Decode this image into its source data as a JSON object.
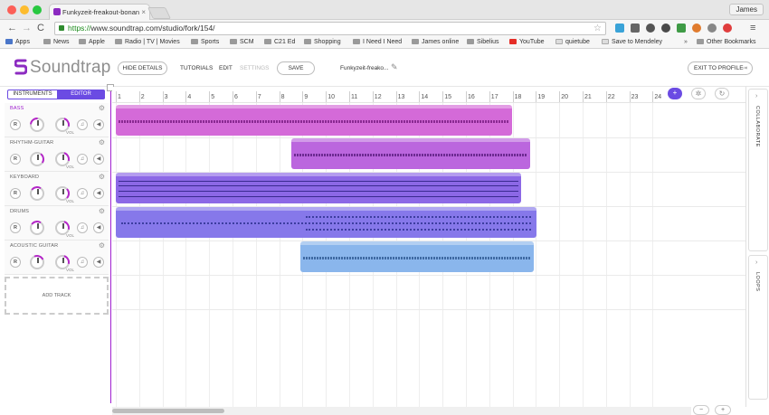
{
  "browser": {
    "tab_title": "Funkyzeit-freakout-bonan",
    "tab_close": "×",
    "user_name": "James",
    "url_scheme": "https://",
    "url_rest": "www.soundtrap.com/studio/fork/154/",
    "bookmarks": [
      "Apps",
      "News",
      "Apple",
      "Radio | TV | Movies",
      "Sports",
      "SCM",
      "C21 Ed",
      "Shopping",
      "I Need I Need",
      "James online",
      "Sibelius",
      "YouTube",
      "quietube",
      "Save to Mendeley",
      "Other Bookmarks"
    ],
    "more_bookmarks": "»"
  },
  "header": {
    "logo_text": "Soundtrap",
    "hide_details": "HIDE DETAILS",
    "tutorials": "TUTORIALS",
    "edit": "EDIT",
    "settings": "SETTINGS",
    "save": "SAVE",
    "project_name": "Funkyzeit-freako...",
    "exit_profile": "EXIT TO PROFILE"
  },
  "sidebar": {
    "tab_instruments": "INSTRUMENTS",
    "tab_editor": "EDITOR",
    "add_track": "ADD TRACK",
    "knob_r": "R",
    "vol_label": "VOL",
    "tracks": [
      {
        "name": "BASS",
        "active": true
      },
      {
        "name": "RHYTHM-GUITAR",
        "active": false
      },
      {
        "name": "KEYBOARD",
        "active": false
      },
      {
        "name": "DRUMS",
        "active": false
      },
      {
        "name": "ACOUSTIC GUITAR",
        "active": false
      }
    ]
  },
  "ruler": {
    "bars": [
      "1",
      "2",
      "3",
      "4",
      "5",
      "6",
      "7",
      "8",
      "9",
      "10",
      "11",
      "12",
      "13",
      "14",
      "15",
      "16",
      "17",
      "18",
      "19",
      "20",
      "21",
      "22",
      "23",
      "24"
    ]
  },
  "right_panel": {
    "collaborate": "COLLABORATE",
    "loops": "LOOPS"
  },
  "colors": {
    "accent": "#6b4be3",
    "bass": "#d46ad8",
    "guitar": "#bb66de",
    "keyboard": "#8c68e6",
    "drums": "#8678ea",
    "acoustic": "#8ab6ec"
  }
}
